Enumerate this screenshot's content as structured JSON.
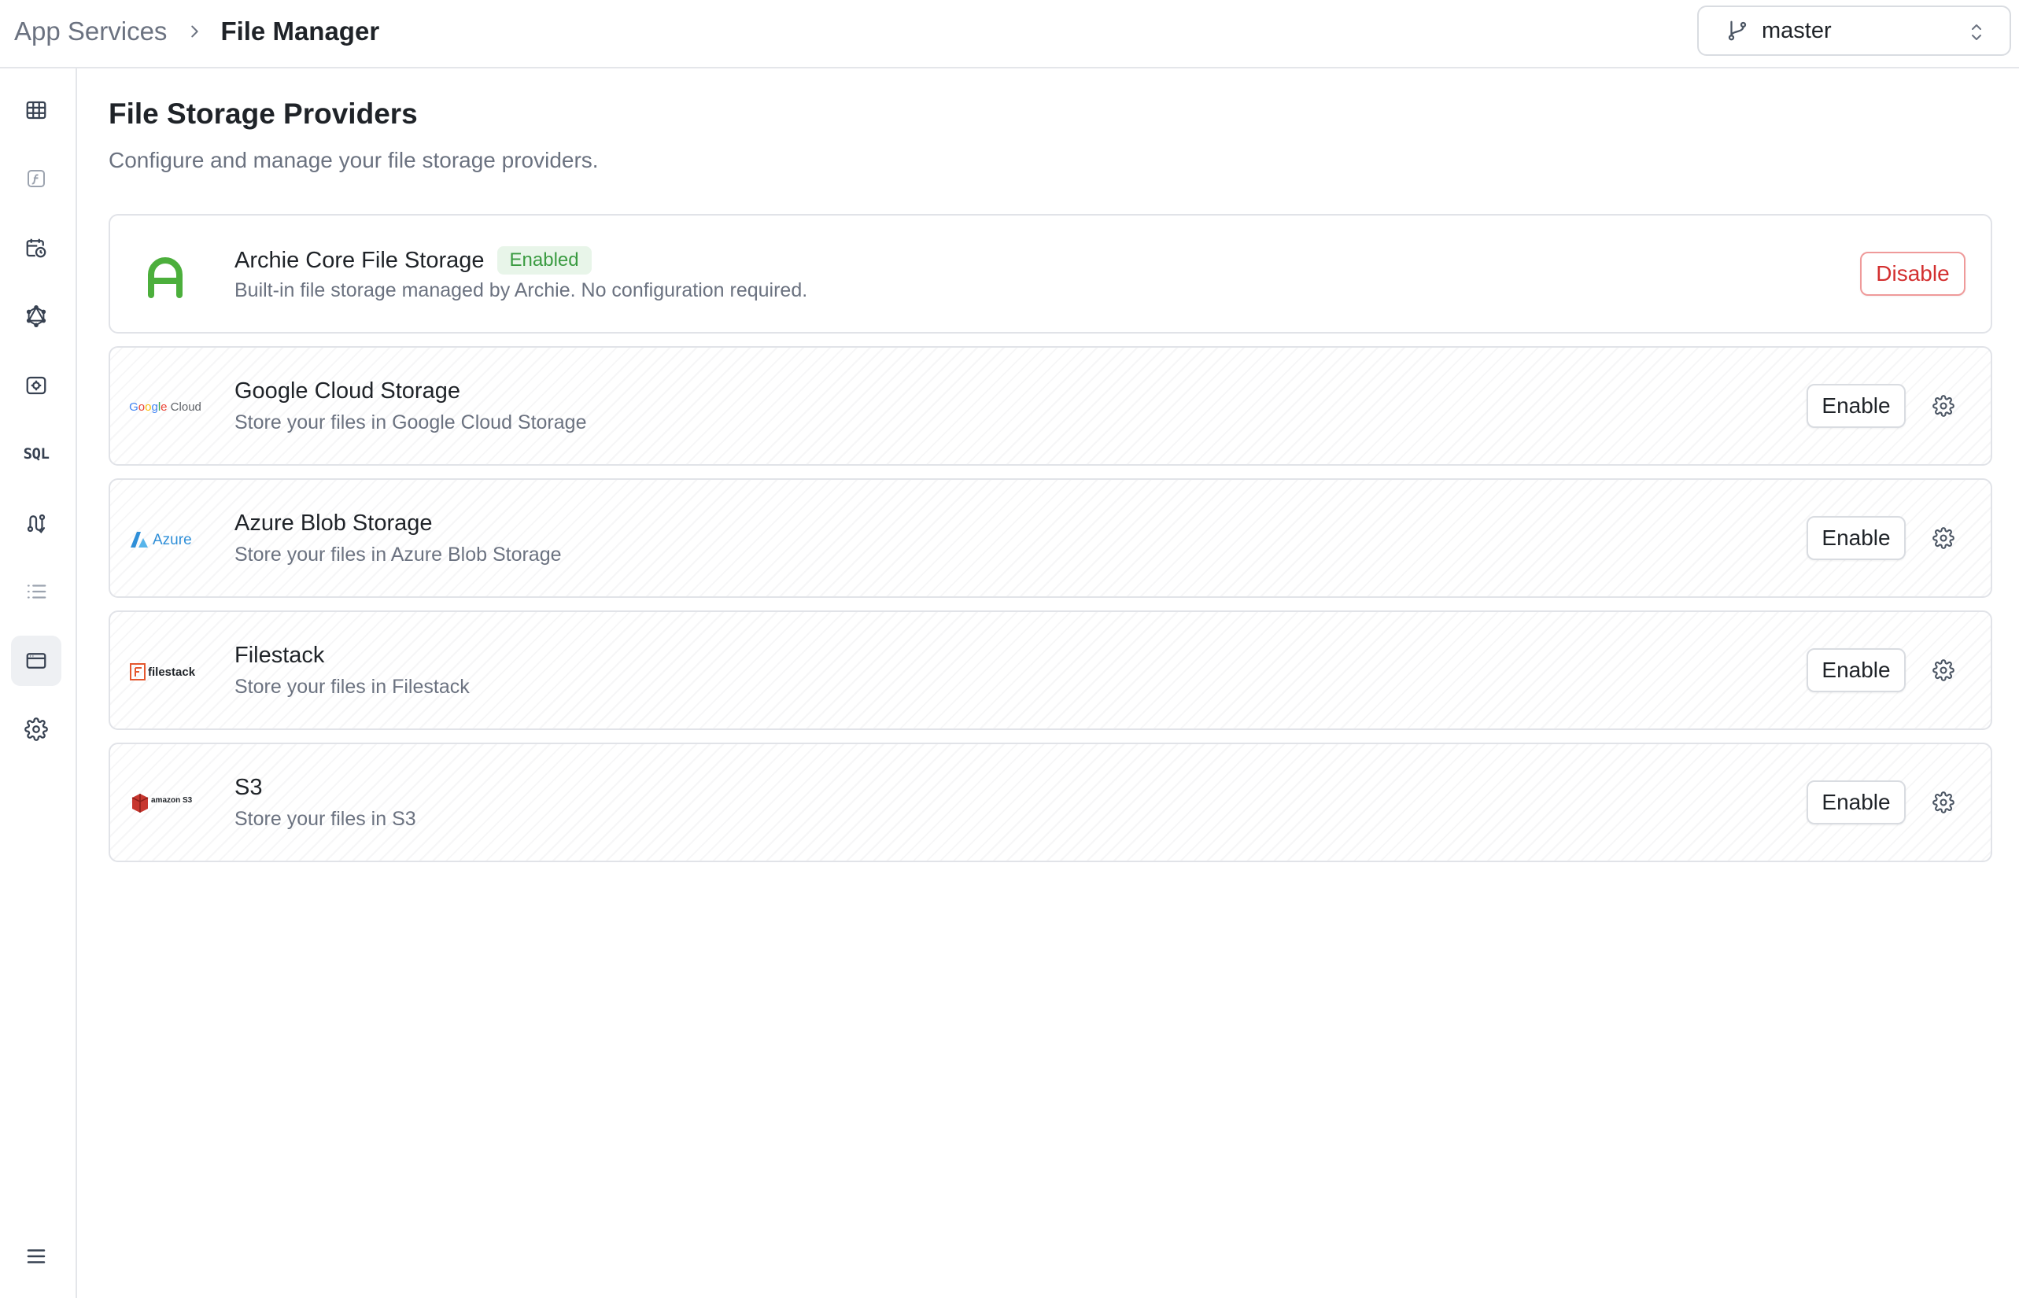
{
  "breadcrumb": {
    "parent": "App Services",
    "current": "File Manager"
  },
  "branch": {
    "name": "master"
  },
  "sidebar": {
    "items": [
      {
        "icon": "table-icon"
      },
      {
        "icon": "function-icon"
      },
      {
        "icon": "schedule-icon"
      },
      {
        "icon": "graphql-icon"
      },
      {
        "icon": "webhook-icon"
      },
      {
        "icon": "sql-icon",
        "label": "SQL"
      },
      {
        "icon": "workflow-icon"
      },
      {
        "icon": "list-icon"
      },
      {
        "icon": "file-manager-icon",
        "active": true
      },
      {
        "icon": "settings-icon"
      },
      {
        "icon": "menu-icon"
      }
    ]
  },
  "page": {
    "title": "File Storage Providers",
    "subtitle": "Configure and manage your file storage providers."
  },
  "providers": [
    {
      "name": "Archie Core File Storage",
      "badge": "Enabled",
      "description": "Built-in file storage managed by Archie. No configuration required.",
      "action": "Disable",
      "logo": "archie-logo"
    },
    {
      "name": "Google Cloud Storage",
      "description": "Store your files in Google Cloud Storage",
      "action": "Enable",
      "logo": "google-cloud-logo",
      "logo_text": "Google Cloud"
    },
    {
      "name": "Azure Blob Storage",
      "description": "Store your files in Azure Blob Storage",
      "action": "Enable",
      "logo": "azure-logo",
      "logo_text": "Azure"
    },
    {
      "name": "Filestack",
      "description": "Store your files in Filestack",
      "action": "Enable",
      "logo": "filestack-logo",
      "logo_text": "filestack"
    },
    {
      "name": "S3",
      "description": "Store your files in S3",
      "action": "Enable",
      "logo": "amazon-s3-logo",
      "logo_text": "amazon S3"
    }
  ],
  "colors": {
    "enabled_badge_bg": "#e8f5e9",
    "enabled_badge_text": "#3a9b41",
    "disable_text": "#d32f2f",
    "archie_green": "#4caf3c"
  }
}
